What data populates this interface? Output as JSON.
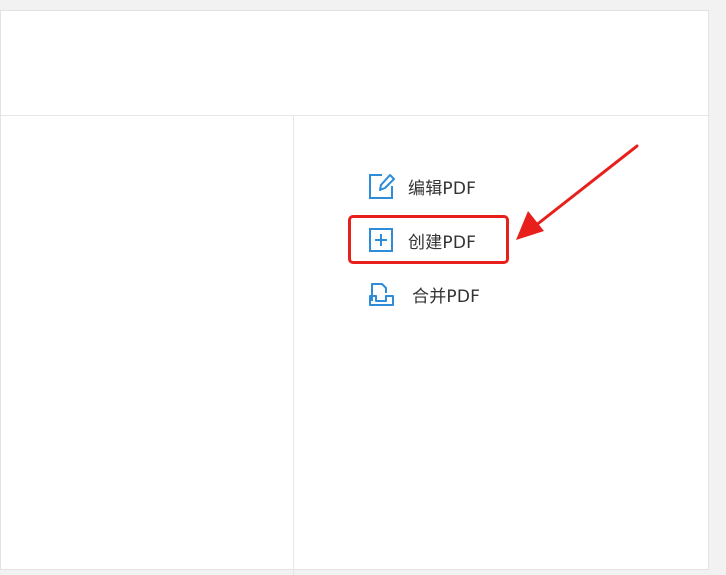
{
  "menu": {
    "items": [
      {
        "label": "编辑PDF",
        "icon": "edit-pen-icon"
      },
      {
        "label": "创建PDF",
        "icon": "plus-square-icon"
      },
      {
        "label": "合并PDF",
        "icon": "merge-docs-icon"
      }
    ]
  },
  "colors": {
    "icon_accent": "#2f8cd8",
    "annotation_red": "#e8201c"
  }
}
